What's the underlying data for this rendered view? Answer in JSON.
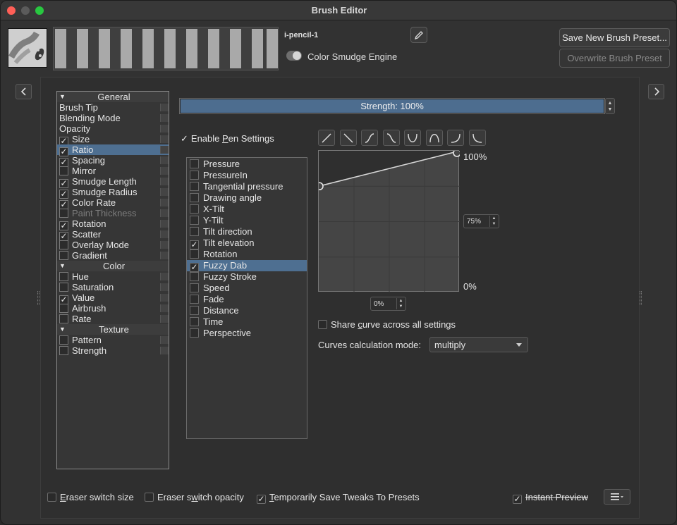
{
  "window": {
    "title": "Brush Editor"
  },
  "preset": {
    "name": "i-pencil-1",
    "engine_label": "Color Smudge Engine",
    "save_label": "Save New Brush Preset...",
    "overwrite_label": "Overwrite Brush Preset"
  },
  "options": [
    {
      "type": "section",
      "label": "General"
    },
    {
      "type": "item",
      "label": "Brush Tip",
      "checkbox": false
    },
    {
      "type": "item",
      "label": "Blending Mode",
      "checkbox": false
    },
    {
      "type": "item",
      "label": "Opacity",
      "checkbox": false
    },
    {
      "type": "item",
      "label": "Size",
      "checkbox": true,
      "checked": true
    },
    {
      "type": "item",
      "label": "Ratio",
      "checkbox": true,
      "checked": true,
      "selected": true
    },
    {
      "type": "item",
      "label": "Spacing",
      "checkbox": true,
      "checked": true
    },
    {
      "type": "item",
      "label": "Mirror",
      "checkbox": true,
      "checked": false
    },
    {
      "type": "item",
      "label": "Smudge Length",
      "checkbox": true,
      "checked": true
    },
    {
      "type": "item",
      "label": "Smudge Radius",
      "checkbox": true,
      "checked": true
    },
    {
      "type": "item",
      "label": "Color Rate",
      "checkbox": true,
      "checked": true
    },
    {
      "type": "item",
      "label": "Paint Thickness",
      "checkbox": true,
      "checked": false,
      "disabled": true
    },
    {
      "type": "item",
      "label": "Rotation",
      "checkbox": true,
      "checked": true
    },
    {
      "type": "item",
      "label": "Scatter",
      "checkbox": true,
      "checked": true
    },
    {
      "type": "item",
      "label": "Overlay Mode",
      "checkbox": true,
      "checked": false
    },
    {
      "type": "item",
      "label": "Gradient",
      "checkbox": true,
      "checked": false
    },
    {
      "type": "section",
      "label": "Color"
    },
    {
      "type": "item",
      "label": "Hue",
      "checkbox": true,
      "checked": false
    },
    {
      "type": "item",
      "label": "Saturation",
      "checkbox": true,
      "checked": false
    },
    {
      "type": "item",
      "label": "Value",
      "checkbox": true,
      "checked": true
    },
    {
      "type": "item",
      "label": "Airbrush",
      "checkbox": true,
      "checked": false
    },
    {
      "type": "item",
      "label": "Rate",
      "checkbox": true,
      "checked": false
    },
    {
      "type": "section",
      "label": "Texture"
    },
    {
      "type": "item",
      "label": "Pattern",
      "checkbox": true,
      "checked": false
    },
    {
      "type": "item",
      "label": "Strength",
      "checkbox": true,
      "checked": false
    }
  ],
  "strength": {
    "label": "Strength: 100%",
    "value": 1.0
  },
  "pen_settings": {
    "pre": "Enable ",
    "accel": "P",
    "post": "en Settings",
    "checked": true
  },
  "sensors": [
    {
      "label": "Pressure",
      "checked": false
    },
    {
      "label": "PressureIn",
      "checked": false
    },
    {
      "label": "Tangential pressure",
      "checked": false
    },
    {
      "label": "Drawing angle",
      "checked": false
    },
    {
      "label": "X-Tilt",
      "checked": false
    },
    {
      "label": "Y-Tilt",
      "checked": false
    },
    {
      "label": "Tilt direction",
      "checked": false
    },
    {
      "label": "Tilt elevation",
      "checked": true
    },
    {
      "label": "Rotation",
      "checked": false
    },
    {
      "label": "Fuzzy Dab",
      "checked": true,
      "selected": true
    },
    {
      "label": "Fuzzy Stroke",
      "checked": false
    },
    {
      "label": "Speed",
      "checked": false
    },
    {
      "label": "Fade",
      "checked": false
    },
    {
      "label": "Distance",
      "checked": false
    },
    {
      "label": "Time",
      "checked": false
    },
    {
      "label": "Perspective",
      "checked": false
    }
  ],
  "curve_presets": [
    "linear-up-icon",
    "linear-down-icon",
    "s-curve-icon",
    "reverse-s-curve-icon",
    "u-curve-icon",
    "arch-curve-icon",
    "convex-curve-icon",
    "concave-curve-icon"
  ],
  "curve": {
    "max_label": "100%",
    "min_label": "0%",
    "y_value": "75%",
    "x_value": "0%",
    "start_value": 0.75,
    "end_value": 1.0,
    "share": {
      "pre": "Share ",
      "accel": "c",
      "post": "urve across all settings",
      "checked": false
    },
    "mode_label": "Curves calculation mode:",
    "mode_value": "multiply"
  },
  "footer": {
    "eraser_size": {
      "accel": "E",
      "post": "raser switch size",
      "checked": false
    },
    "eraser_opacity": {
      "pre": "Eraser s",
      "accel": "w",
      "post": "itch opacity",
      "checked": false
    },
    "save_tweaks": {
      "accel": "T",
      "post": "emporarily Save Tweaks To Presets",
      "checked": true
    },
    "instant_preview": {
      "label": "Instant Preview",
      "checked": true
    }
  },
  "colors": {
    "accent": "#4e6f91",
    "background": "#323232"
  }
}
